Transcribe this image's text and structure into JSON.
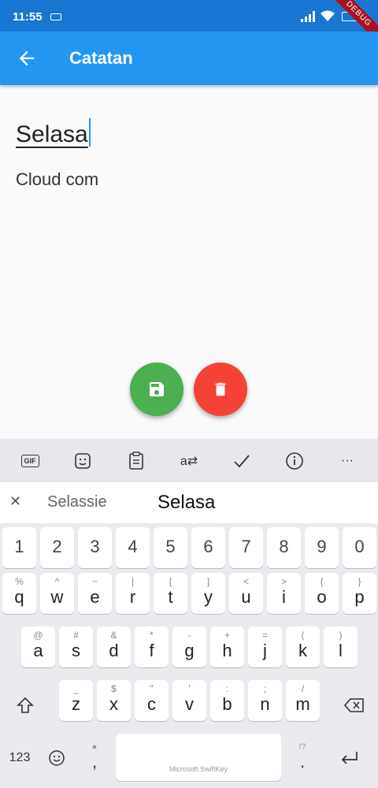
{
  "status": {
    "time": "11:55",
    "debug_label": "DEBUG"
  },
  "appbar": {
    "title": "Catatan"
  },
  "note": {
    "title": "Selasa",
    "body": "Cloud com"
  },
  "keyboard": {
    "toolbar": [
      "gif-icon",
      "sticker-icon",
      "clipboard-icon",
      "translate-icon",
      "check-icon",
      "info-icon",
      "more-icon"
    ],
    "gif_label": "GIF",
    "more_label": "···",
    "suggestions": {
      "left": "Selassie",
      "center": "Selasa"
    },
    "numbers": [
      "1",
      "2",
      "3",
      "4",
      "5",
      "6",
      "7",
      "8",
      "9",
      "0"
    ],
    "row1": [
      [
        "q",
        "%"
      ],
      [
        "w",
        "^"
      ],
      [
        "e",
        "~"
      ],
      [
        "r",
        "|"
      ],
      [
        "t",
        "["
      ],
      [
        "y",
        "]"
      ],
      [
        "u",
        "<"
      ],
      [
        "i",
        ">"
      ],
      [
        "o",
        "{"
      ],
      [
        "p",
        "}"
      ]
    ],
    "row2": [
      [
        "a",
        "@"
      ],
      [
        "s",
        "#"
      ],
      [
        "d",
        "&"
      ],
      [
        "f",
        "*"
      ],
      [
        "g",
        "-"
      ],
      [
        "h",
        "+"
      ],
      [
        "j",
        "="
      ],
      [
        "k",
        "("
      ],
      [
        "l",
        ")"
      ]
    ],
    "row3": [
      [
        "z",
        "_"
      ],
      [
        "x",
        "$"
      ],
      [
        "c",
        "\""
      ],
      [
        "v",
        "'"
      ],
      [
        "b",
        ":"
      ],
      [
        "n",
        ";"
      ],
      [
        "m",
        "/"
      ]
    ],
    "num_switch": "123",
    "comma": ",",
    "period": ".",
    "period_alt": "!?",
    "space_brand": "Microsoft SwiftKey"
  }
}
